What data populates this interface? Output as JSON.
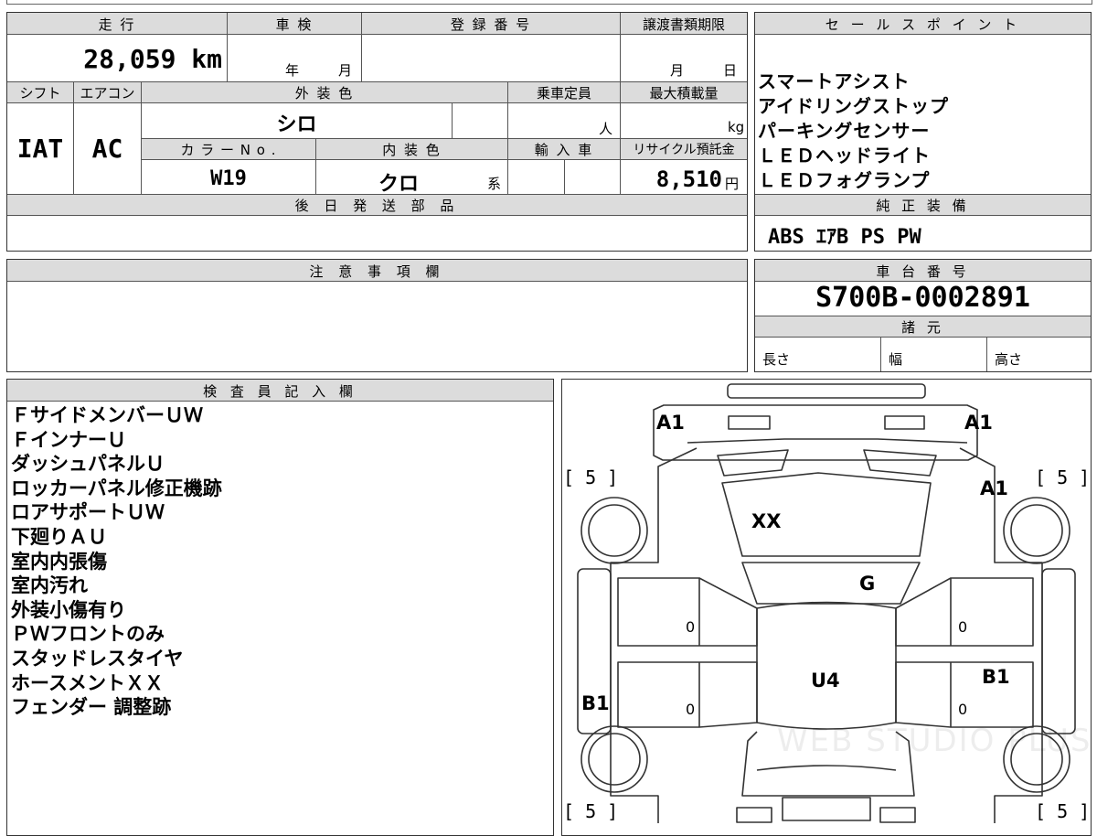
{
  "main": {
    "mileage_label": "走 行",
    "mileage_value": "28,059 km",
    "shaken_label": "車 検",
    "shaken_year": "年",
    "shaken_month": "月",
    "registration_label": "登 録 番 号",
    "transfer_label": "譲渡書類期限",
    "transfer_month": "月",
    "transfer_day": "日",
    "shift_label": "シフト",
    "shift_value": "IAT",
    "ac_label": "エアコン",
    "ac_value": "AC",
    "exterior_label": "外 装 色",
    "exterior_value": "シロ",
    "capacity_label": "乗車定員",
    "capacity_unit": "人",
    "maxload_label": "最大積載量",
    "maxload_unit": "kg",
    "colorno_label": "カ ラ ー N o .",
    "colorno_value": "W19",
    "interior_label": "内 装 色",
    "interior_value": "クロ",
    "interior_suffix": "系",
    "import_label": "輸 入 車",
    "recycle_label": "リサイクル預託金",
    "recycle_value": "8,510",
    "recycle_unit": "円",
    "later_parts_label": "後 日 発 送 部 品"
  },
  "sales": {
    "label": "セ ー ル ス ポ イ ン ト",
    "points": [
      "スマートアシスト",
      "アイドリングストップ",
      "パーキングセンサー",
      "ＬＥＤヘッドライト",
      "ＬＥＤフォグランプ"
    ]
  },
  "equipment": {
    "label": "純 正 装 備",
    "value": "ABS ｴｱB PS PW"
  },
  "caution": {
    "label": "注 意 事 項 欄"
  },
  "chassis": {
    "label": "車 台 番 号",
    "value": "S700B-0002891"
  },
  "specs": {
    "label": "諸 元",
    "length": "長さ",
    "width": "幅",
    "height": "高さ"
  },
  "inspector": {
    "label": "検 査 員 記 入 欄",
    "notes": [
      "ＦサイドメンバーＵＷ",
      "ＦインナーＵ",
      "ダッシュパネルＵ",
      "ロッカーパネル修正機跡",
      "ロアサポートＵＷ",
      "下廻りＡＵ",
      "室内内張傷",
      "室内汚れ",
      "外装小傷有り",
      "ＰＷフロントのみ",
      "スタッドレスタイヤ",
      "ホースメントＸＸ",
      "フェンダー 調整跡"
    ]
  },
  "diagram": {
    "marks": {
      "a1_front_left": "A1",
      "a1_front_right": "A1",
      "a1_right_fender": "A1",
      "windshield": "XX",
      "hood": "G",
      "roof": "U4",
      "b1_right": "B1",
      "b1_left": "B1",
      "door_fl": "0",
      "door_rl": "0",
      "door_fr": "0",
      "door_rr": "0"
    },
    "tire_tl": "[ 5 ]",
    "tire_tr": "[ 5 ]",
    "tire_bl": "[ 5 ]",
    "tire_br": "[ 5 ]",
    "watermark": "WEB STUDIO PLUS"
  }
}
